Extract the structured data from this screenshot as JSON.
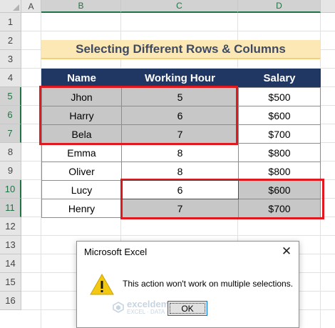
{
  "columns": [
    "A",
    "B",
    "C",
    "D"
  ],
  "rows": [
    "1",
    "2",
    "3",
    "4",
    "5",
    "6",
    "7",
    "8",
    "9",
    "10",
    "11",
    "12",
    "13",
    "14",
    "15",
    "16"
  ],
  "selected_rows": [
    5,
    6,
    7,
    10,
    11
  ],
  "title": "Selecting Different Rows & Columns",
  "table": {
    "headers": [
      "Name",
      "Working Hour",
      "Salary"
    ],
    "rows": [
      [
        "Jhon",
        "5",
        "$500"
      ],
      [
        "Harry",
        "6",
        "$600"
      ],
      [
        "Bela",
        "7",
        "$700"
      ],
      [
        "Emma",
        "8",
        "$800"
      ],
      [
        "Oliver",
        "8",
        "$800"
      ],
      [
        "Lucy",
        "6",
        "$600"
      ],
      [
        "Henry",
        "7",
        "$700"
      ]
    ]
  },
  "dialog": {
    "title": "Microsoft Excel",
    "close": "✕",
    "message": "This action won't work on multiple selections.",
    "ok_label": "OK",
    "watermark": "exceldemy",
    "watermark_sub": "EXCEL · DATA · BI"
  },
  "colors": {
    "header": "#203764",
    "selection_gray": "#c7c7c7",
    "highlight": "#e2181f",
    "title_bg": "#fce8b4"
  }
}
